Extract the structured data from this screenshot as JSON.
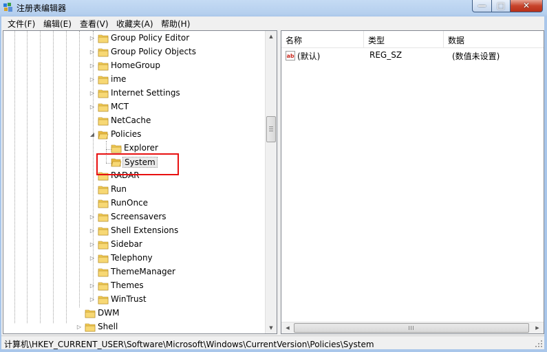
{
  "window": {
    "title": "注册表编辑器",
    "controls": {
      "minimize": "—",
      "maximize": "□",
      "close": "✕"
    }
  },
  "menu": [
    "文件(F)",
    "编辑(E)",
    "查看(V)",
    "收藏夹(A)",
    "帮助(H)"
  ],
  "tree": {
    "nodes": [
      {
        "label": "Group Policy Editor",
        "expander": "▷"
      },
      {
        "label": "Group Policy Objects",
        "expander": "▷"
      },
      {
        "label": "HomeGroup",
        "expander": "▷"
      },
      {
        "label": "ime",
        "expander": "▷"
      },
      {
        "label": "Internet Settings",
        "expander": "▷"
      },
      {
        "label": "MCT",
        "expander": "▷"
      },
      {
        "label": "NetCache",
        "expander": ""
      },
      {
        "label": "Policies",
        "expander": "◢"
      },
      {
        "label": "Explorer",
        "expander": ""
      },
      {
        "label": "System",
        "expander": "",
        "selected": true
      },
      {
        "label": "RADAR",
        "expander": ""
      },
      {
        "label": "Run",
        "expander": ""
      },
      {
        "label": "RunOnce",
        "expander": ""
      },
      {
        "label": "Screensavers",
        "expander": "▷"
      },
      {
        "label": "Shell Extensions",
        "expander": "▷"
      },
      {
        "label": "Sidebar",
        "expander": "▷"
      },
      {
        "label": "Telephony",
        "expander": "▷"
      },
      {
        "label": "ThemeManager",
        "expander": ""
      },
      {
        "label": "Themes",
        "expander": "▷"
      },
      {
        "label": "WinTrust",
        "expander": "▷"
      },
      {
        "label": "DWM",
        "expander": ""
      },
      {
        "label": "Shell",
        "expander": "▷"
      }
    ]
  },
  "list": {
    "columns": [
      "名称",
      "类型",
      "数据"
    ],
    "rows": [
      {
        "name": "(默认)",
        "type": "REG_SZ",
        "data": "(数值未设置)"
      }
    ]
  },
  "status": {
    "path": "计算机\\HKEY_CURRENT_USER\\Software\\Microsoft\\Windows\\CurrentVersion\\Policies\\System"
  },
  "colors": {
    "highlight": "#e81010",
    "folder": "#f2cc55",
    "title_bg": "#c5dbf4"
  }
}
